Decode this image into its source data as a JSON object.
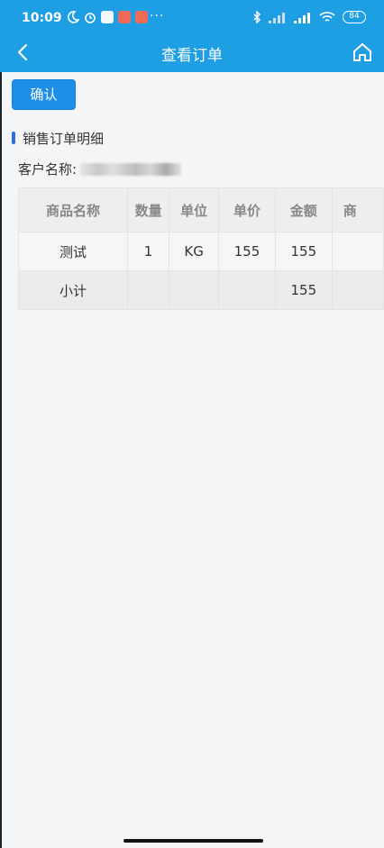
{
  "status_bar": {
    "time": "10:09",
    "more": "···",
    "battery": "84"
  },
  "header": {
    "title": "查看订单"
  },
  "actions": {
    "confirm_label": "确认"
  },
  "section": {
    "title": "销售订单明细"
  },
  "customer": {
    "label": "客户名称:"
  },
  "table": {
    "headers": [
      "商品名称",
      "数量",
      "单位",
      "单价",
      "金额",
      "商"
    ],
    "rows": [
      [
        "测试",
        "1",
        "KG",
        "155",
        "155",
        ""
      ]
    ],
    "subtotal": [
      "小计",
      "",
      "",
      "",
      "155",
      ""
    ]
  },
  "colors": {
    "header_bg": "#1e9fe4",
    "confirm_bg": "#1e8fe8",
    "section_mark": "#2a6fe8"
  },
  "icons": [
    "moon-icon",
    "alarm-icon",
    "app-icon",
    "bluetooth-icon",
    "signal-icon",
    "wifi-icon",
    "battery-icon",
    "back-icon",
    "home-icon"
  ]
}
